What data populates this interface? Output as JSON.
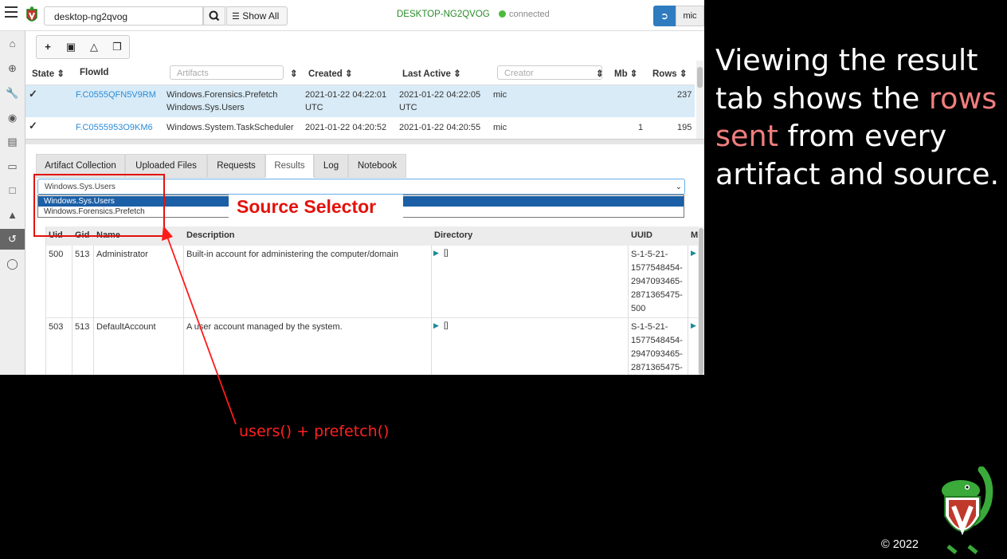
{
  "navbar": {
    "client_search_value": "desktop-ng2qvog",
    "show_all_label": "Show All",
    "hostname": "DESKTOP-NG2QVOG",
    "connection_status": "connected",
    "user_label": "mic"
  },
  "flows_table": {
    "headers": {
      "state": "State",
      "flowid": "FlowId",
      "artifacts_placeholder": "Artifacts",
      "created": "Created",
      "last_active": "Last Active",
      "creator_placeholder": "Creator",
      "mb": "Mb",
      "rows": "Rows"
    },
    "rows": [
      {
        "flow_id": "F.C0555QFN5V9RM",
        "artifact_1": "Windows.Forensics.Prefetch",
        "artifact_2": "Windows.Sys.Users",
        "created_1": "2021-01-22 04:22:01",
        "created_2": "UTC",
        "last_active_1": "2021-01-22 04:22:05",
        "last_active_2": "UTC",
        "creator": "mic",
        "mb": "",
        "rows": "237"
      },
      {
        "flow_id": "F.C0555953O9KM6",
        "artifact_1": "Windows.System.TaskScheduler",
        "created_1": "2021-01-22 04:20:52",
        "last_active_1": "2021-01-22 04:20:55",
        "creator": "mic",
        "mb": "1",
        "rows": "195"
      }
    ]
  },
  "tabs": [
    "Artifact Collection",
    "Uploaded Files",
    "Requests",
    "Results",
    "Log",
    "Notebook"
  ],
  "source_selector": {
    "selected": "Windows.Sys.Users",
    "options": [
      "Windows.Sys.Users",
      "Windows.Forensics.Prefetch"
    ],
    "callout": "Source Selector"
  },
  "results_table": {
    "headers": {
      "uid": "Uid",
      "gid": "Gid",
      "name": "Name",
      "description": "Description",
      "directory": "Directory",
      "uuid": "UUID",
      "more": "M"
    },
    "rows": [
      {
        "uid": "500",
        "gid": "513",
        "name": "Administrator",
        "description": "Built-in account for administering the computer/domain",
        "directory": "[]",
        "uuid_lines": [
          "S-1-5-21-",
          "1577548454-",
          "2947093465-",
          "2871365475-",
          "500"
        ]
      },
      {
        "uid": "503",
        "gid": "513",
        "name": "DefaultAccount",
        "description": "A user account managed by the system.",
        "directory": "[]",
        "uuid_lines": [
          "S-1-5-21-",
          "1577548454-",
          "2947093465-",
          "2871365475-"
        ]
      }
    ]
  },
  "slide": {
    "headline_part1": "Viewing the result tab shows the ",
    "headline_highlight": "rows sent",
    "headline_part2": " from every artifact and source.",
    "annotation": "users() + prefetch()",
    "copyright": "© 2022"
  },
  "colors": {
    "accent_red": "#e3120b",
    "highlight_pink": "#f07e7e",
    "link_blue": "#2a8cd8",
    "selected_row": "#d8ebf7",
    "dropdown_highlight": "#1b5fa6"
  }
}
